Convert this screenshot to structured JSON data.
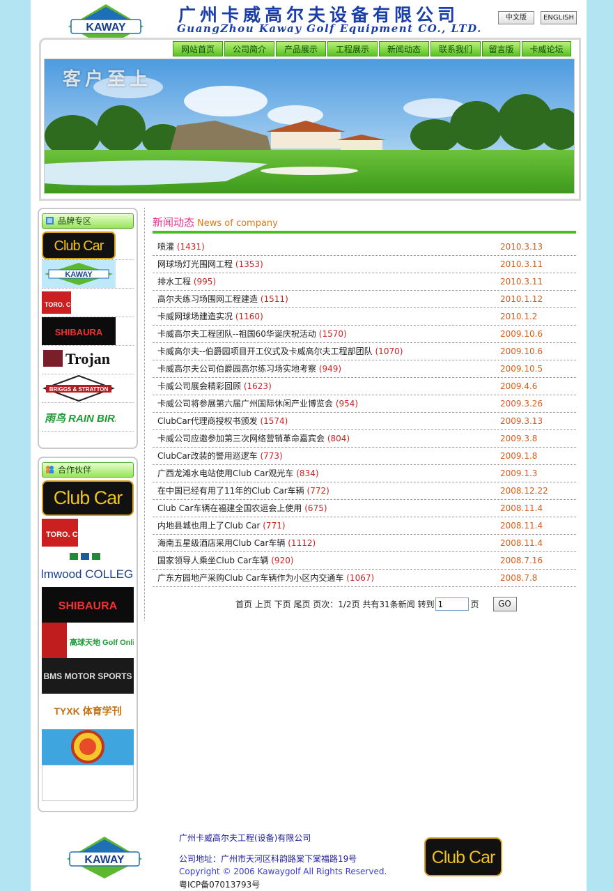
{
  "header": {
    "logo_text": "KAWAY",
    "company_cn": "广州卡威高尔夫设备有限公司",
    "company_en": "GuangZhou Kaway Golf Equipment CO., LTD.",
    "lang_cn": "中文版",
    "lang_en": "ENGLISH"
  },
  "nav": [
    "网站首页",
    "公司简介",
    "产品展示",
    "工程展示",
    "新闻动态",
    "联系我们",
    "留言版",
    "卡威论坛"
  ],
  "banner": {
    "slogan": "客户至上"
  },
  "sidebar": {
    "brands_title": "品牌专区",
    "brands": [
      "Club Car",
      "KAWAY",
      "TORO. Count on it.",
      "SHIBAURA",
      "Trojan",
      "BRIGGS & STRATTON",
      "雨鸟 RAIN BIRD"
    ],
    "partners_title": "合作伙伴",
    "partners": [
      "Club Car",
      "TORO. Count on it.",
      "elmwood COLLEGE",
      "SHIBAURA",
      "高球天地 Golf Onlife .com",
      "BMS MOTOR SPORTS",
      "TYXK 体育学刊",
      ""
    ]
  },
  "news": {
    "title_cn": "新闻动态",
    "title_en": "News of company",
    "items": [
      {
        "title": "喷灌",
        "count": "(1431)",
        "date": "2010.3.13"
      },
      {
        "title": "网球场灯光围网工程",
        "count": "(1353)",
        "date": "2010.3.11"
      },
      {
        "title": "排水工程",
        "count": "(995)",
        "date": "2010.3.11"
      },
      {
        "title": "高尔夫练习场围网工程建造",
        "count": "(1511)",
        "date": "2010.1.12"
      },
      {
        "title": "卡威网球场建造实况",
        "count": "(1160)",
        "date": "2010.1.2"
      },
      {
        "title": "卡威高尔夫工程团队--祖国60华诞庆祝活动",
        "count": "(1570)",
        "date": "2009.10.6"
      },
      {
        "title": "卡威高尔夫--伯爵园项目开工仪式及卡威高尔夫工程部团队",
        "count": "(1070)",
        "date": "2009.10.6"
      },
      {
        "title": "卡威高尔夫公司伯爵园高尔练习场实地考察",
        "count": "(949)",
        "date": "2009.10.5"
      },
      {
        "title": "卡威公司展会精彩回顾",
        "count": "(1623)",
        "date": "2009.4.6"
      },
      {
        "title": "卡威公司将参展第六届广州国际休闲产业博览会",
        "count": "(954)",
        "date": "2009.3.26"
      },
      {
        "title": "ClubCar代理商授权书颁发",
        "count": "(1574)",
        "date": "2009.3.13"
      },
      {
        "title": "卡威公司应邀参加第三次网络营销革命嘉宾会",
        "count": "(804)",
        "date": "2009.3.8"
      },
      {
        "title": "ClubCar改装的警用巡逻车",
        "count": "(773)",
        "date": "2009.1.8"
      },
      {
        "title": "广西龙滩水电站使用Club Car观光车",
        "count": "(834)",
        "date": "2009.1.3"
      },
      {
        "title": "在中国已经有用了11年的Club Car车辆",
        "count": "(772)",
        "date": "2008.12.22"
      },
      {
        "title": "Club Car车辆在福建全国农运会上使用",
        "count": "(675)",
        "date": "2008.11.4"
      },
      {
        "title": "内地县城也用上了Club Car",
        "count": "(771)",
        "date": "2008.11.4"
      },
      {
        "title": "海南五星级酒店采用Club Car车辆",
        "count": "(1112)",
        "date": "2008.11.4"
      },
      {
        "title": "国家领导人乘坐Club Car车辆",
        "count": "(920)",
        "date": "2008.7.16"
      },
      {
        "title": "广东方园地产采购Club Car车辆作为小区内交通车",
        "count": "(1067)",
        "date": "2008.7.8"
      }
    ]
  },
  "pager": {
    "text": "首页 上页 下页 尾页 页次：1/2页 共有31条新闻 转到",
    "page_value": "1",
    "page_suffix": "页",
    "go_label": "GO"
  },
  "footer": {
    "logo_text": "KAWAY",
    "company": "广州卡威高尔夫工程(设备)有限公司",
    "address": "公司地址：广州市天河区科韵路棠下棠福路19号",
    "copyright": "Copyright © 2006 Kawaygolf All Rights Reserved.",
    "icp": "粤ICP备07013793号",
    "brand_logo": "Club Car"
  },
  "colors": {
    "nav_green": "#58c21f",
    "news_pink": "#e0338a",
    "date_orange": "#d55c1c",
    "count_red": "#cc2222",
    "bg_blue": "#b3e4f2"
  }
}
